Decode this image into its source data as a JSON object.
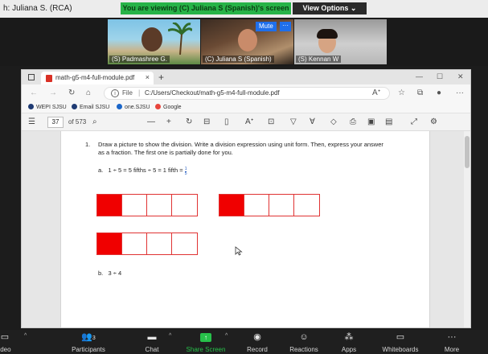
{
  "zoom_top": {
    "viewer_name": "h: Juliana S. (RCA)",
    "banner": "You are viewing (C) Juliana S (Spanish)'s screen",
    "view_options": "View Options ⌄"
  },
  "participants": [
    {
      "label": "(S) Padmashree G."
    },
    {
      "label": "(C) Juliana S (Spanish)",
      "mute": "Mute",
      "more": "···"
    },
    {
      "label": "(S) Kennan W"
    }
  ],
  "browser": {
    "tab_title": "math-g5-m4-full-module.pdf",
    "tab_close": "×",
    "new_tab": "+",
    "window_controls": [
      "—",
      "☐",
      "✕"
    ],
    "file_label": "File",
    "url": "C:/Users/Checkout/math-g5-m4-full-module.pdf",
    "favorites": [
      {
        "label": "WEPI SJSU",
        "color": "#1f3b73"
      },
      {
        "label": "Email SJSU",
        "color": "#1f3b73"
      },
      {
        "label": "one.SJSU",
        "color": "#1b66c9"
      },
      {
        "label": "Google",
        "color": "#e8453c"
      }
    ],
    "pdf_toolbar": {
      "page": "37",
      "page_of": "of 573"
    }
  },
  "document": {
    "question_number": "1.",
    "question_text": "Draw a picture to show the division.  Write a division expression using unit form.  Then, express your answer as a fraction.  The first one is partially done for you.",
    "part_a_label": "a.",
    "part_a_expr": "1 ÷ 5 = 5 fifths ÷ 5 = 1 fifth =",
    "part_a_frac_num": "1",
    "part_a_frac_den": "5",
    "part_b_label": "b.",
    "part_b_expr": "3 ÷ 4",
    "fraction_strips": [
      {
        "cells": 4,
        "filled": 1
      },
      {
        "cells": 4,
        "filled": 1
      },
      {
        "cells": 4,
        "filled": 1
      }
    ]
  },
  "toolbar": {
    "video_label": "ideo",
    "participants_label": "Participants",
    "participants_count": "3",
    "chat_label": "Chat",
    "share_label": "Share Screen",
    "record_label": "Record",
    "reactions_label": "Reactions",
    "apps_label": "Apps",
    "whiteboards_label": "Whiteboards",
    "more_label": "More"
  },
  "colors": {
    "banner_green": "#27b348",
    "share_green": "#27c04a",
    "strip_red": "#f00000"
  }
}
